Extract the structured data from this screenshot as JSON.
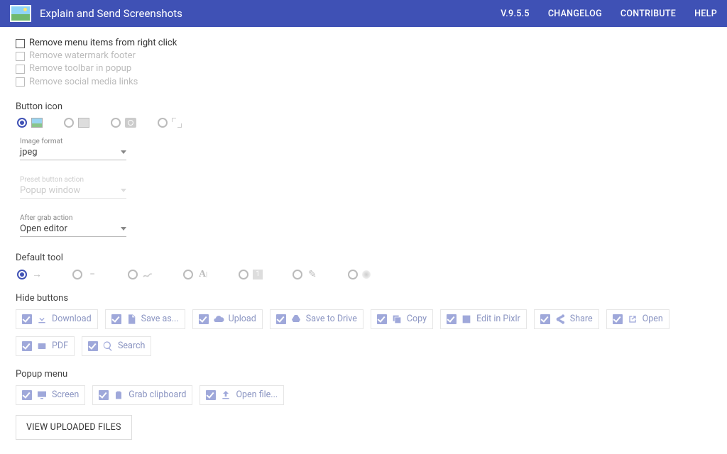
{
  "header": {
    "title": "Explain and Send Screenshots",
    "version": "V.9.5.5",
    "links": {
      "changelog": "CHANGELOG",
      "contribute": "CONTRIBUTE",
      "help": "HELP"
    }
  },
  "removeOptions": {
    "menuItems": "Remove menu items from right click",
    "watermark": "Remove watermark footer",
    "toolbar": "Remove toolbar in popup",
    "social": "Remove social media links"
  },
  "sections": {
    "buttonIcon": "Button icon",
    "defaultTool": "Default tool",
    "hideButtons": "Hide buttons",
    "popupMenu": "Popup menu"
  },
  "selects": {
    "imageFormat": {
      "label": "Image format",
      "value": "jpeg"
    },
    "presetAction": {
      "label": "Preset button action",
      "value": "Popup window"
    },
    "afterGrab": {
      "label": "After grab action",
      "value": "Open editor"
    }
  },
  "hideButtons": {
    "download": "Download",
    "saveAs": "Save as...",
    "upload": "Upload",
    "saveDrive": "Save to Drive",
    "copy": "Copy",
    "editPixlr": "Edit in Pixlr",
    "share": "Share",
    "open": "Open",
    "pdf": "PDF",
    "search": "Search"
  },
  "popupMenu": {
    "screen": "Screen",
    "grabClipboard": "Grab clipboard",
    "openFile": "Open file..."
  },
  "viewUploaded": "VIEW UPLOADED FILES"
}
